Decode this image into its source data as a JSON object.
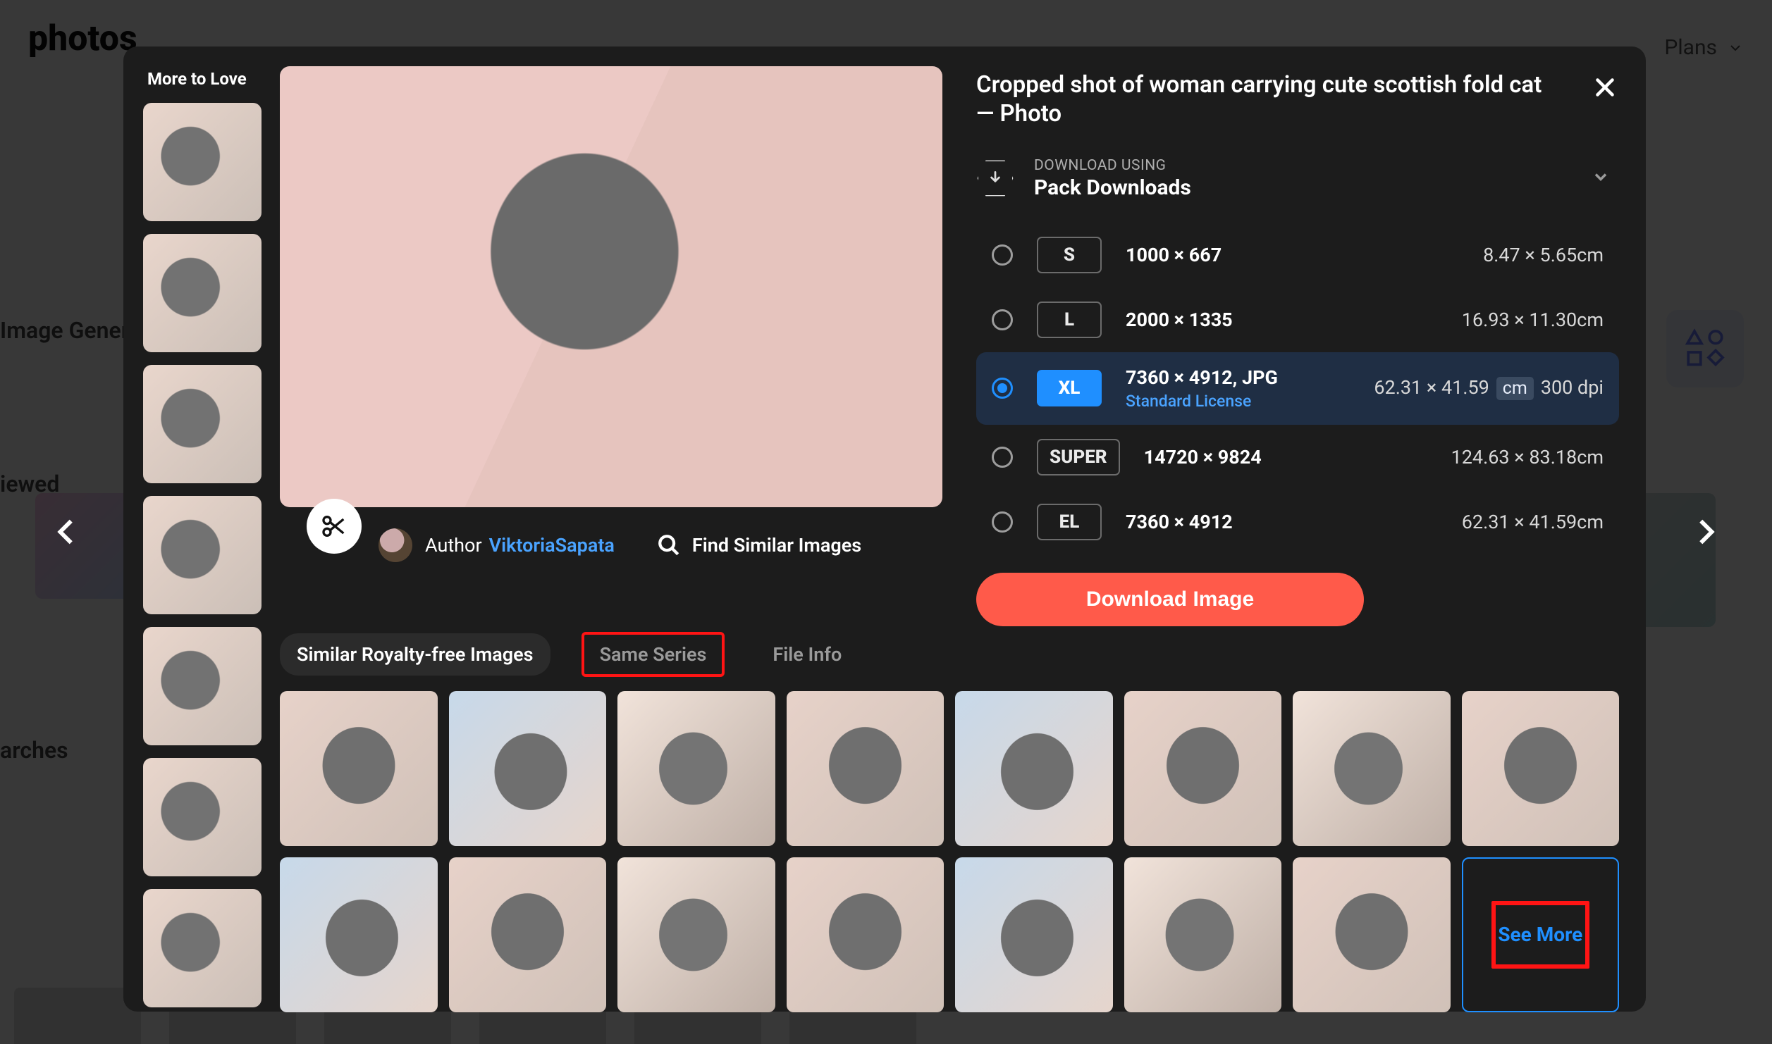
{
  "background": {
    "logo": "photos",
    "plans_label": "Plans",
    "sidebar": {
      "ai_label": "Image Generator",
      "viewed_label": "iewed",
      "searches_label": "arches"
    }
  },
  "modal": {
    "title": "Cropped shot of woman carrying cute scottish fold cat — Photo",
    "more_to_love_label": "More to Love",
    "more_to_love_count": 7,
    "author_label": "Author",
    "author_name": "ViktoriaSapata",
    "find_similar_label": "Find Similar Images",
    "download_using_small": "DOWNLOAD USING",
    "download_using_value": "Pack Downloads",
    "sizes": [
      {
        "code": "S",
        "dims": "1000 × 667",
        "phys": "8.47 × 5.65cm",
        "selected": false
      },
      {
        "code": "L",
        "dims": "2000 × 1335",
        "phys": "16.93 × 11.30cm",
        "selected": false
      },
      {
        "code": "XL",
        "dims": "7360 × 4912, JPG",
        "phys": "62.31 × 41.59",
        "unit": "cm",
        "dpi": "300 dpi",
        "license": "Standard License",
        "selected": true
      },
      {
        "code": "SUPER",
        "dims": "14720 × 9824",
        "phys": "124.63 × 83.18cm",
        "selected": false
      },
      {
        "code": "EL",
        "dims": "7360 × 4912",
        "phys": "62.31 × 41.59cm",
        "selected": false
      }
    ],
    "download_button": "Download Image",
    "tabs": {
      "similar": "Similar Royalty-free Images",
      "same_series": "Same Series",
      "file_info": "File Info",
      "active": "similar",
      "highlight": "same_series"
    },
    "similar_count": 15,
    "see_more_label": "See More"
  }
}
